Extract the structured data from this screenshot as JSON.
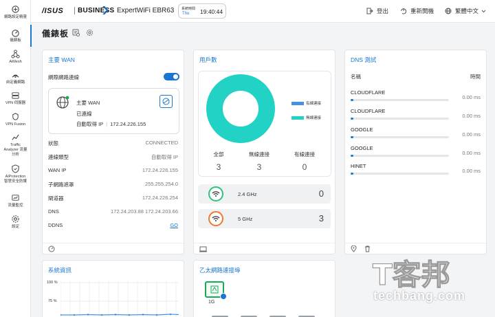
{
  "sidebar": {
    "items": [
      {
        "label": "網路設定精靈",
        "icon": "wizard-icon"
      },
      {
        "label": "儀錶板",
        "icon": "dashboard-icon"
      },
      {
        "label": "AiMesh",
        "icon": "aimesh-icon"
      },
      {
        "label": "自定義網路",
        "icon": "custom-network-icon"
      },
      {
        "label": "VPN 伺服器",
        "icon": "vpn-server-icon"
      },
      {
        "label": "VPN Fusion",
        "icon": "vpn-fusion-icon"
      },
      {
        "label_line1": "Traffic",
        "label_line2": "Analyzer 流量",
        "label_line3": "分析",
        "icon": "traffic-analyzer-icon"
      },
      {
        "label_line1": "AiProtection",
        "label_line2": "智慧安全防護",
        "icon": "aiprotection-icon"
      },
      {
        "label": "流量監控",
        "icon": "traffic-monitor-icon"
      },
      {
        "label": "設定",
        "icon": "settings-icon"
      }
    ]
  },
  "header": {
    "brand": "/ISUS",
    "business": "BUSINESS",
    "model": "ExpertWiFi EBR63",
    "clock": {
      "tz": "系統時間",
      "day": "Thu",
      "time": "19:40:44"
    },
    "logout": "登出",
    "reboot": "重新開機",
    "language": "繁體中文"
  },
  "page": {
    "title": "儀錶板"
  },
  "wan": {
    "title": "主要 WAN",
    "internet_label": "網際網路連線",
    "internet_on": true,
    "box": {
      "name": "主要 WAN",
      "status": "已連線",
      "ip_label": "自動取得 IP",
      "ip": "172.24.226.155"
    },
    "rows": [
      {
        "k": "狀態",
        "v": "CONNECTED"
      },
      {
        "k": "連線類型",
        "v": "自動取得 IP"
      },
      {
        "k": "WAN IP",
        "v": "172.24.226.155"
      },
      {
        "k": "子網路遮罩",
        "v": "255.255.254.0"
      },
      {
        "k": "閘道器",
        "v": "172.24.226.254"
      },
      {
        "k": "DNS",
        "v": "172.24.203.88 172.24.203.66"
      },
      {
        "k": "DDNS",
        "v": "GO"
      }
    ]
  },
  "clients": {
    "title": "用戶數",
    "legend": [
      {
        "label": "有線連接",
        "color": "#4a90e2"
      },
      {
        "label": "無線連接",
        "color": "#22d3c5"
      }
    ],
    "donut": {
      "wired": 0,
      "wireless": 3
    },
    "stats": [
      {
        "label": "全部",
        "value": "3"
      },
      {
        "label": "無線連接",
        "value": "3"
      },
      {
        "label": "有線連接",
        "value": "0"
      }
    ],
    "bands": [
      {
        "name": "2.4 GHz",
        "value": "0",
        "color": "#2ec27e"
      },
      {
        "name": "5 GHz",
        "value": "3",
        "color": "#f07a2a"
      }
    ]
  },
  "dns": {
    "title": "DNS 測試",
    "col_name": "名稱",
    "col_time": "時間",
    "rows": [
      {
        "name": "CLOUDFLARE",
        "time": "0.00 ms"
      },
      {
        "name": "CLOUDFLARE",
        "time": "0.00 ms"
      },
      {
        "name": "GOOGLE",
        "time": "0.00 ms"
      },
      {
        "name": "GOOGLE",
        "time": "0.00 ms"
      },
      {
        "name": "HINET",
        "time": "0.00 ms"
      }
    ]
  },
  "system": {
    "title": "系統資訊",
    "axis": [
      "100 %",
      "75 %"
    ]
  },
  "ethernet": {
    "title": "乙太網路連接埠",
    "port": {
      "speed": "1G"
    }
  },
  "watermark": {
    "logo": "T客邦",
    "url": "techbang.com"
  }
}
